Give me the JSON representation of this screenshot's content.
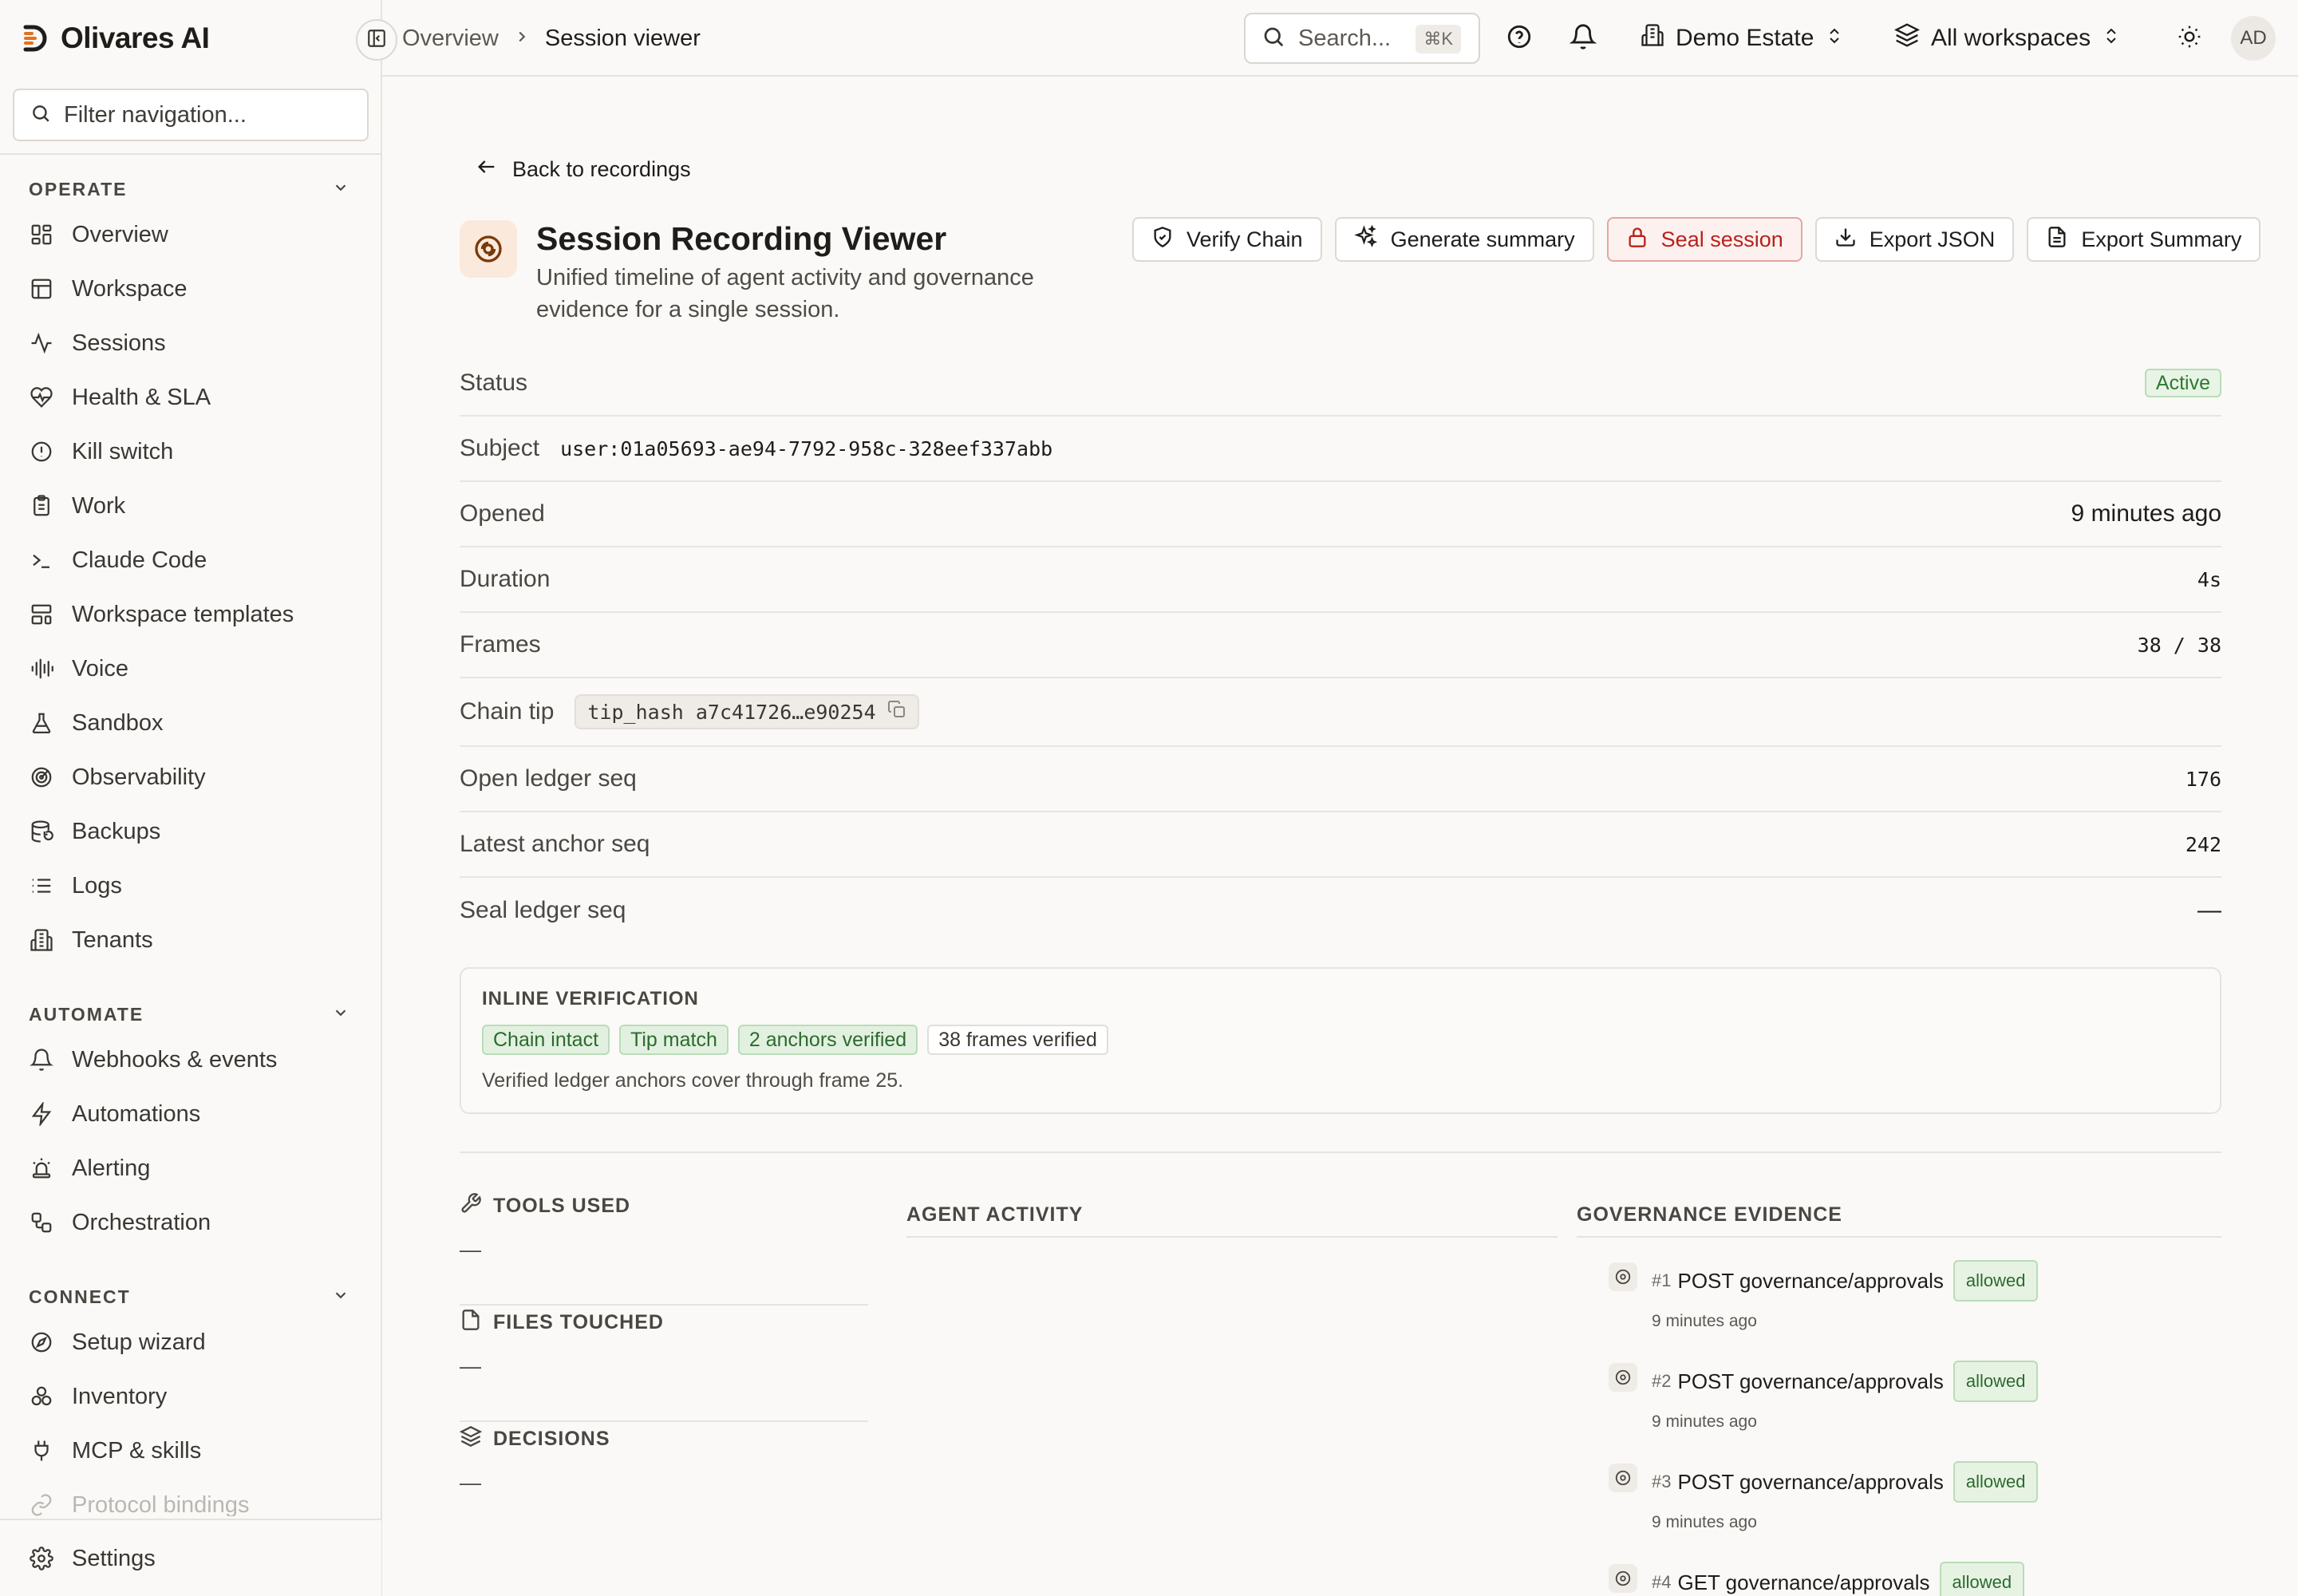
{
  "app": {
    "name": "Olivares AI"
  },
  "breadcrumb": {
    "parent": "Overview",
    "current": "Session viewer"
  },
  "search": {
    "placeholder": "Search...",
    "shortcut": "⌘K"
  },
  "org_switcher": {
    "label": "Demo Estate"
  },
  "workspace_switcher": {
    "label": "All workspaces"
  },
  "user": {
    "initials": "AD"
  },
  "sidebar": {
    "filter_placeholder": "Filter navigation...",
    "sections": [
      {
        "label": "OPERATE",
        "items": [
          {
            "label": "Overview",
            "icon": "layout-dashboard-icon"
          },
          {
            "label": "Workspace",
            "icon": "layout-panel-icon"
          },
          {
            "label": "Sessions",
            "icon": "activity-icon"
          },
          {
            "label": "Health & SLA",
            "icon": "heart-pulse-icon"
          },
          {
            "label": "Kill switch",
            "icon": "alert-circle-icon"
          },
          {
            "label": "Work",
            "icon": "clipboard-icon"
          },
          {
            "label": "Claude Code",
            "icon": "terminal-icon"
          },
          {
            "label": "Workspace templates",
            "icon": "template-icon"
          },
          {
            "label": "Voice",
            "icon": "audio-lines-icon"
          },
          {
            "label": "Sandbox",
            "icon": "flask-icon"
          },
          {
            "label": "Observability",
            "icon": "radar-icon"
          },
          {
            "label": "Backups",
            "icon": "database-backup-icon"
          },
          {
            "label": "Logs",
            "icon": "list-icon"
          },
          {
            "label": "Tenants",
            "icon": "building-icon"
          }
        ]
      },
      {
        "label": "AUTOMATE",
        "items": [
          {
            "label": "Webhooks & events",
            "icon": "bell-icon"
          },
          {
            "label": "Automations",
            "icon": "zap-icon"
          },
          {
            "label": "Alerting",
            "icon": "siren-icon"
          },
          {
            "label": "Orchestration",
            "icon": "workflow-icon"
          }
        ]
      },
      {
        "label": "CONNECT",
        "items": [
          {
            "label": "Setup wizard",
            "icon": "compass-icon"
          },
          {
            "label": "Inventory",
            "icon": "boxes-icon"
          },
          {
            "label": "MCP & skills",
            "icon": "plug-icon"
          },
          {
            "label": "Protocol bindings",
            "icon": "link-icon"
          }
        ]
      }
    ],
    "settings_label": "Settings"
  },
  "page": {
    "back_label": "Back to recordings",
    "title": "Session Recording Viewer",
    "subtitle": "Unified timeline of agent activity and governance evidence for a single session.",
    "actions": {
      "verify": "Verify Chain",
      "summary": "Generate summary",
      "seal": "Seal session",
      "export_json": "Export JSON",
      "export_summary": "Export Summary"
    }
  },
  "details": {
    "status": {
      "label": "Status",
      "value": "Active"
    },
    "subject": {
      "label": "Subject",
      "value": "user:01a05693-ae94-7792-958c-328eef337abb"
    },
    "opened": {
      "label": "Opened",
      "value": "9 minutes ago"
    },
    "duration": {
      "label": "Duration",
      "value": "4s"
    },
    "frames": {
      "label": "Frames",
      "value": "38 / 38"
    },
    "chain_tip": {
      "label": "Chain tip",
      "value": "tip_hash a7c41726…e90254"
    },
    "open_ledger_seq": {
      "label": "Open ledger seq",
      "value": "176"
    },
    "latest_anchor_seq": {
      "label": "Latest anchor seq",
      "value": "242"
    },
    "seal_ledger_seq": {
      "label": "Seal ledger seq",
      "value": "—"
    }
  },
  "verification": {
    "title": "INLINE VERIFICATION",
    "badges": [
      "Chain intact",
      "Tip match",
      "2 anchors verified",
      "38 frames verified"
    ],
    "note": "Verified ledger anchors cover through frame 25."
  },
  "side_panels": {
    "tools": {
      "title": "TOOLS USED",
      "value": "—"
    },
    "files": {
      "title": "FILES TOUCHED",
      "value": "—"
    },
    "decisions": {
      "title": "DECISIONS",
      "value": "—"
    }
  },
  "columns": {
    "agent_activity": "AGENT ACTIVITY",
    "governance_evidence": "GOVERNANCE EVIDENCE"
  },
  "evidence": [
    {
      "num": "#1",
      "title": "POST governance/approvals",
      "badge": "allowed",
      "time": "9 minutes ago"
    },
    {
      "num": "#2",
      "title": "POST governance/approvals",
      "badge": "allowed",
      "time": "9 minutes ago"
    },
    {
      "num": "#3",
      "title": "POST governance/approvals",
      "badge": "allowed",
      "time": "9 minutes ago"
    },
    {
      "num": "#4",
      "title": "GET governance/approvals",
      "badge": "allowed",
      "time": ""
    }
  ],
  "colors": {
    "accent": "#c2570c",
    "danger": "#b8221a",
    "success": "#2c7a30",
    "background": "#faf9f7"
  }
}
